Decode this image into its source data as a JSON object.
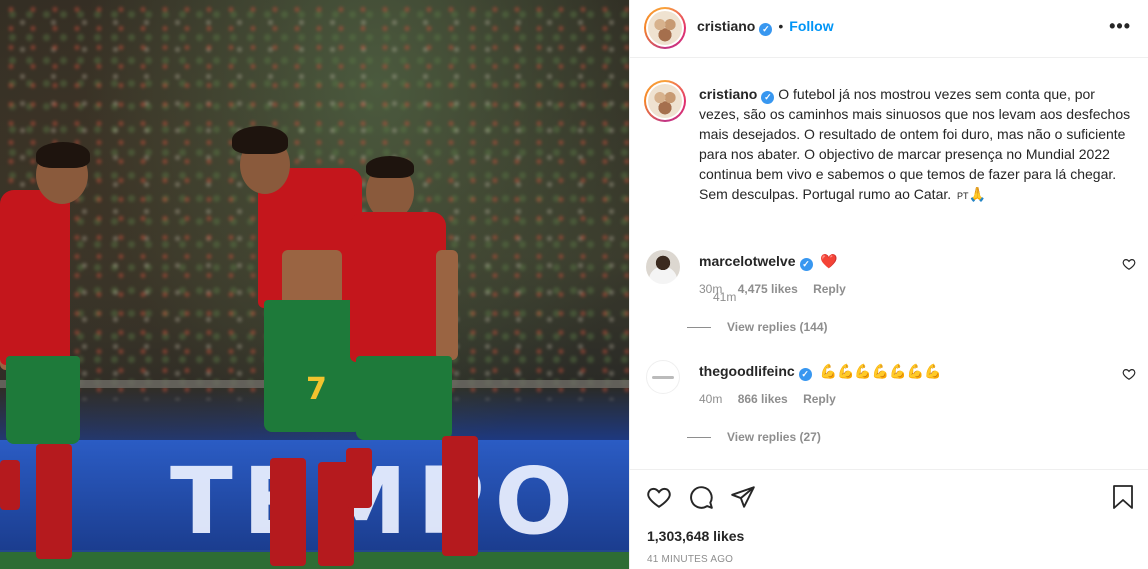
{
  "post": {
    "username": "cristiano",
    "follow_label": "Follow",
    "more_label": "•••",
    "caption": "O futebol já nos mostrou vezes sem conta que, por vezes, são os caminhos mais sinuosos que nos levam aos desfechos mais desejados. O resultado de ontem foi duro, mas não o suficiente para nos abater. O objectivo de marcar presença no Mundial 2022 continua bem vivo e sabemos o que temos de fazer para lá chegar. Sem desculpas. Portugal rumo ao Catar.",
    "caption_flag": "PT",
    "caption_emoji": "🙏",
    "caption_time": "41m"
  },
  "image": {
    "board_text": "TEMPO",
    "player_number": "7"
  },
  "comments": [
    {
      "username": "marcelotwelve",
      "text": "❤️",
      "time": "30m",
      "likes": "4,475 likes",
      "reply_label": "Reply",
      "view_replies": "View replies (144)"
    },
    {
      "username": "thegoodlifeinc",
      "text": "💪💪💪💪💪💪💪",
      "time": "40m",
      "likes": "866 likes",
      "reply_label": "Reply",
      "view_replies": "View replies (27)"
    }
  ],
  "footer": {
    "likes": "1,303,648 likes",
    "time_ago": "41 MINUTES AGO"
  },
  "colors": {
    "accent": "#0095f6",
    "verified": "#3897f0",
    "heart": "#ed4956",
    "kit_red": "#c4161c",
    "kit_green": "#1e7a3a"
  }
}
